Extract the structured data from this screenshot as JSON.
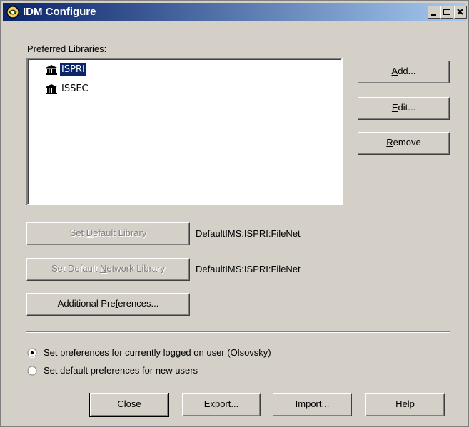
{
  "window": {
    "title": "IDM Configure",
    "minimize_icon": "minimize-icon",
    "maximize_icon": "maximize-icon",
    "close_icon": "close-icon"
  },
  "libraries": {
    "label": "Preferred Libraries:",
    "label_mnemonic": "P",
    "label_rest": "referred Libraries:",
    "icon": "library-building-icon",
    "items": [
      {
        "name": "ISPRI",
        "selected": true
      },
      {
        "name": "ISSEC",
        "selected": false
      }
    ]
  },
  "side_buttons": {
    "add": {
      "pre": "",
      "key": "A",
      "post": "dd..."
    },
    "edit": {
      "pre": "",
      "key": "E",
      "post": "dit..."
    },
    "remove": {
      "pre": "",
      "key": "R",
      "post": "emove"
    }
  },
  "defaults": {
    "set_default": {
      "pre": "Set ",
      "key": "D",
      "post": "efault Library"
    },
    "default_value": "DefaultIMS:ISPRI:FileNet",
    "set_network": {
      "pre": "Set Default ",
      "key": "N",
      "post": "etwork Library"
    },
    "network_value": "DefaultIMS:ISPRI:FileNet",
    "additional": {
      "pre": "Additional Pre",
      "key": "f",
      "post": "erences..."
    }
  },
  "scope": {
    "option_current": "Set preferences for currently logged on user (Olsovsky)",
    "option_new": "Set default preferences for new users",
    "selected": "current"
  },
  "footer": {
    "close": {
      "pre": "",
      "key": "C",
      "post": "lose"
    },
    "export": {
      "pre": "Exp",
      "key": "o",
      "post": "rt..."
    },
    "import": {
      "pre": "",
      "key": "I",
      "post": "mport..."
    },
    "help": {
      "pre": "",
      "key": "H",
      "post": "elp"
    }
  },
  "colors": {
    "face": "#d4d0c8",
    "title_start": "#0a246a",
    "title_end": "#a6caf0",
    "selection": "#0a246a",
    "disabled_text": "#808080"
  }
}
